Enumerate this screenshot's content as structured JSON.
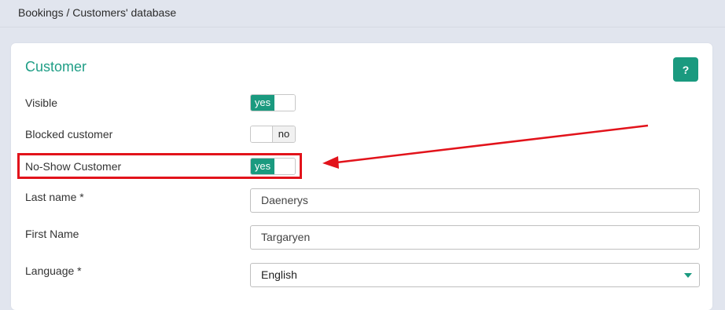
{
  "breadcrumb": "Bookings / Customers' database",
  "card": {
    "title": "Customer",
    "help_label": "?"
  },
  "fields": {
    "visible": {
      "label": "Visible",
      "value": "yes"
    },
    "blocked": {
      "label": "Blocked customer",
      "value": "no"
    },
    "no_show": {
      "label": "No-Show Customer",
      "value": "yes"
    },
    "last_name": {
      "label": "Last name *",
      "value": "Daenerys"
    },
    "first_name": {
      "label": "First Name",
      "value": "Targaryen"
    },
    "language": {
      "label": "Language *",
      "value": "English"
    }
  },
  "colors": {
    "accent": "#1a9a7f",
    "annotation": "#e2131b"
  }
}
